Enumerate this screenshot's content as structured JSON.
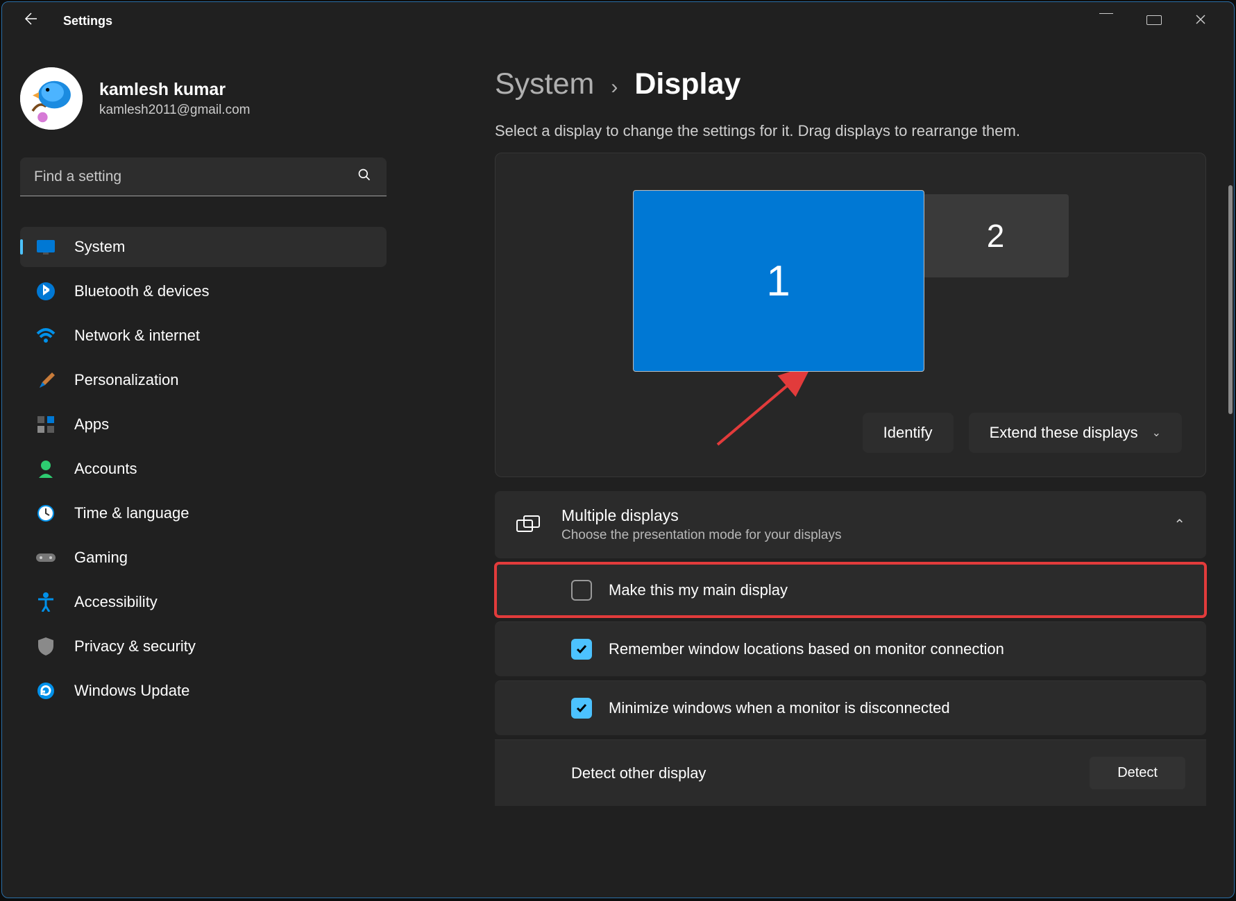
{
  "window": {
    "app_title": "Settings"
  },
  "profile": {
    "name": "kamlesh kumar",
    "email": "kamlesh2011@gmail.com"
  },
  "search": {
    "placeholder": "Find a setting"
  },
  "nav": {
    "items": [
      {
        "label": "System"
      },
      {
        "label": "Bluetooth & devices"
      },
      {
        "label": "Network & internet"
      },
      {
        "label": "Personalization"
      },
      {
        "label": "Apps"
      },
      {
        "label": "Accounts"
      },
      {
        "label": "Time & language"
      },
      {
        "label": "Gaming"
      },
      {
        "label": "Accessibility"
      },
      {
        "label": "Privacy & security"
      },
      {
        "label": "Windows Update"
      }
    ]
  },
  "breadcrumb": {
    "parent": "System",
    "sep": "›",
    "current": "Display"
  },
  "display": {
    "subtitle": "Select a display to change the settings for it. Drag displays to rearrange them.",
    "mon1": "1",
    "mon2": "2",
    "identify_btn": "Identify",
    "extend_label": "Extend these displays"
  },
  "multi": {
    "title": "Multiple displays",
    "subtitle": "Choose the presentation mode for your displays",
    "main_display_label": "Make this my main display",
    "remember_label": "Remember window locations based on monitor connection",
    "minimize_label": "Minimize windows when a monitor is disconnected",
    "detect_label": "Detect other display",
    "detect_btn": "Detect"
  }
}
